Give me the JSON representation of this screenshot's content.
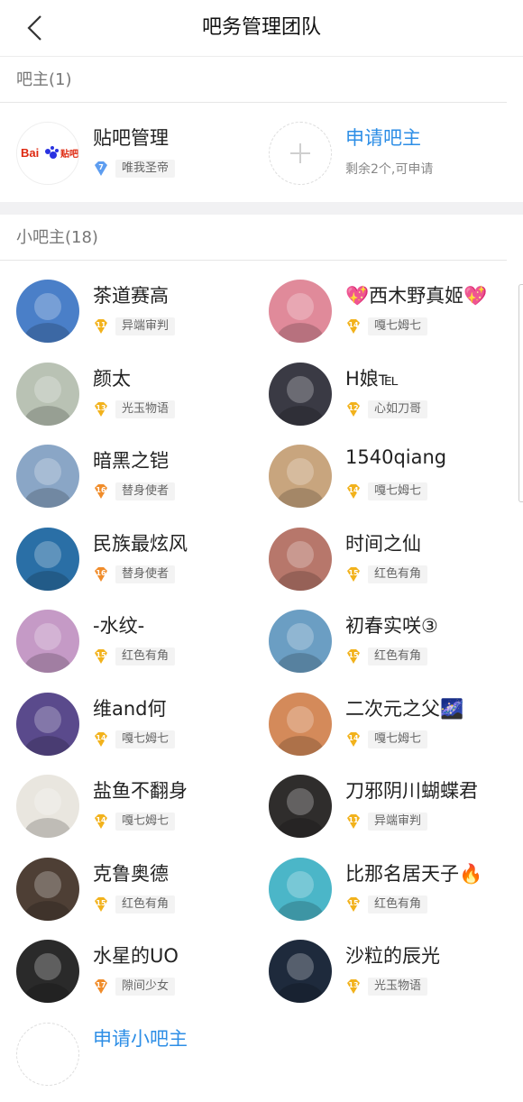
{
  "header": {
    "title": "吧务管理团队",
    "back_icon": "chevron-left-icon"
  },
  "owner_section": {
    "label": "吧主(1)",
    "owner": {
      "name": "贴吧管理",
      "level": "7",
      "tag": "唯我圣帝",
      "logo_text": "Bai贴吧"
    },
    "apply": {
      "label": "申请吧主",
      "sub": "剩余2个,可申请"
    }
  },
  "sub_section": {
    "label": "小吧主(18)",
    "members": [
      {
        "name": "茶道赛高",
        "level": "11",
        "tag": "异端审判",
        "color": "#4a7fc8"
      },
      {
        "name": "💖西木野真姬💖",
        "level": "14",
        "tag": "嘎七姆七",
        "color": "#e08a9a"
      },
      {
        "name": "颜太",
        "level": "13",
        "tag": "光玉物语",
        "color": "#b9c2b4"
      },
      {
        "name": "H娘℡",
        "level": "12",
        "tag": "心如刀哥",
        "color": "#3a3a44"
      },
      {
        "name": "暗黑之铠",
        "level": "16",
        "tag": "替身使者",
        "color": "#8aa6c6"
      },
      {
        "name": "1540qiang",
        "level": "14",
        "tag": "嘎七姆七",
        "color": "#c8a57e"
      },
      {
        "name": "民族最炫风",
        "level": "16",
        "tag": "替身使者",
        "color": "#2a6fa6"
      },
      {
        "name": "时间之仙",
        "level": "15",
        "tag": "红色有角",
        "color": "#b7776b"
      },
      {
        "name": "-水纹-",
        "level": "15",
        "tag": "红色有角",
        "color": "#c59ac6"
      },
      {
        "name": "初春实咲③",
        "level": "15",
        "tag": "红色有角",
        "color": "#6b9ec3"
      },
      {
        "name": "维and何",
        "level": "14",
        "tag": "嘎七姆七",
        "color": "#5a4a8c"
      },
      {
        "name": "二次元之父🌌",
        "level": "14",
        "tag": "嘎七姆七",
        "color": "#d48a5a"
      },
      {
        "name": "盐鱼不翻身",
        "level": "14",
        "tag": "嘎七姆七",
        "color": "#e9e6df"
      },
      {
        "name": "刀邪阴川蝴蝶君",
        "level": "11",
        "tag": "异端审判",
        "color": "#2f2d2c"
      },
      {
        "name": "克鲁奥德",
        "level": "15",
        "tag": "红色有角",
        "color": "#4e3f35"
      },
      {
        "name": "比那名居天子🔥",
        "level": "15",
        "tag": "红色有角",
        "color": "#4bb6c8"
      },
      {
        "name": "水星的UO",
        "level": "17",
        "tag": "隙间少女",
        "color": "#2a2a2a"
      },
      {
        "name": "沙粒的辰光",
        "level": "13",
        "tag": "光玉物语",
        "color": "#1e2a3c"
      }
    ],
    "apply_label": "申请小吧主"
  },
  "colors": {
    "accent": "#2d8ee6",
    "badge_gold": "#f2b21c",
    "badge_orange": "#f08c2a",
    "badge_blue": "#5d9df0"
  }
}
